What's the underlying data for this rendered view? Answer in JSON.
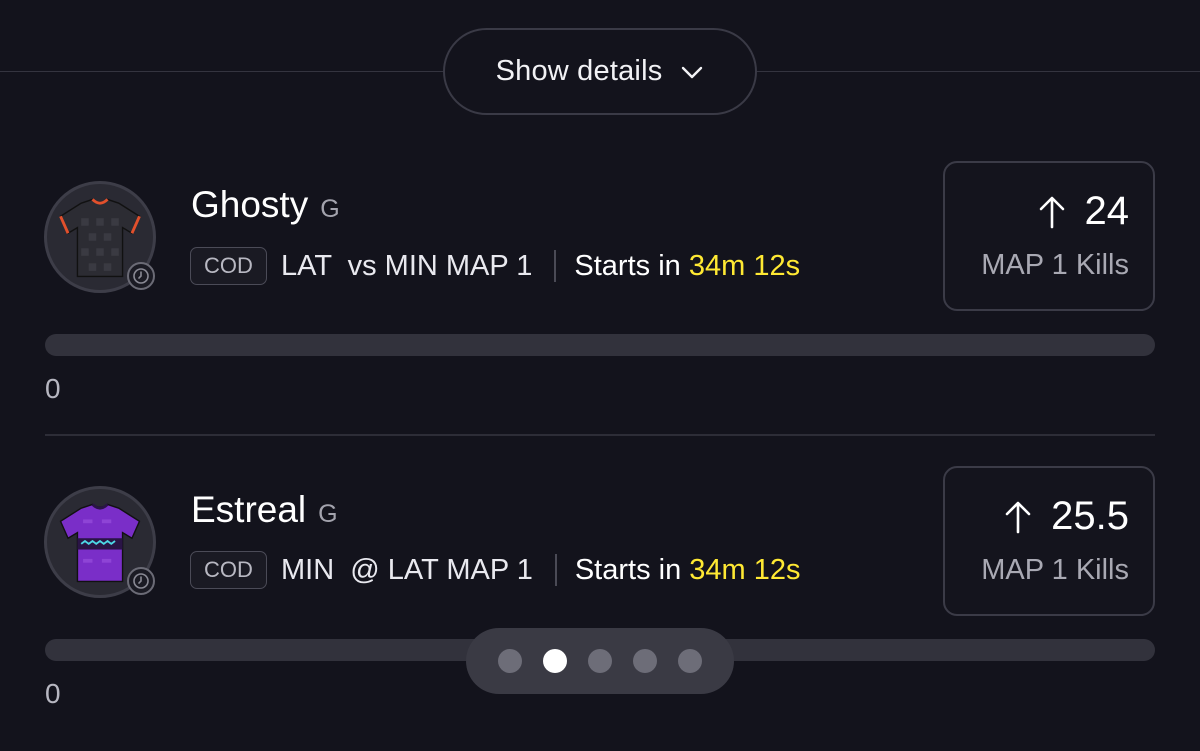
{
  "details_toggle": {
    "label": "Show details",
    "icon": "chevron-down-icon"
  },
  "players": [
    {
      "name": "Ghosty",
      "position": "G",
      "game": "COD",
      "match": "LAT  vs MIN MAP 1",
      "starts_prefix": "Starts in ",
      "starts_time": "34m 12s",
      "stat_value": "24",
      "stat_label": "MAP 1 Kills",
      "progress_value": "0",
      "progress_fraction": 0,
      "jersey_colors": {
        "body": "#2c2c33",
        "trim": "#e2502c"
      }
    },
    {
      "name": "Estreal",
      "position": "G",
      "game": "COD",
      "match": "MIN  @ LAT MAP 1",
      "starts_prefix": "Starts in ",
      "starts_time": "34m 12s",
      "stat_value": "25.5",
      "stat_label": "MAP 1 Kills",
      "progress_value": "0",
      "progress_fraction": 0,
      "jersey_colors": {
        "body": "#7a2ec8",
        "trim": "#2a1446"
      }
    }
  ],
  "pager": {
    "count": 5,
    "active_index": 1
  },
  "colors": {
    "background": "#13131c",
    "accent": "#ffe933",
    "muted": "#a9a9b3"
  }
}
